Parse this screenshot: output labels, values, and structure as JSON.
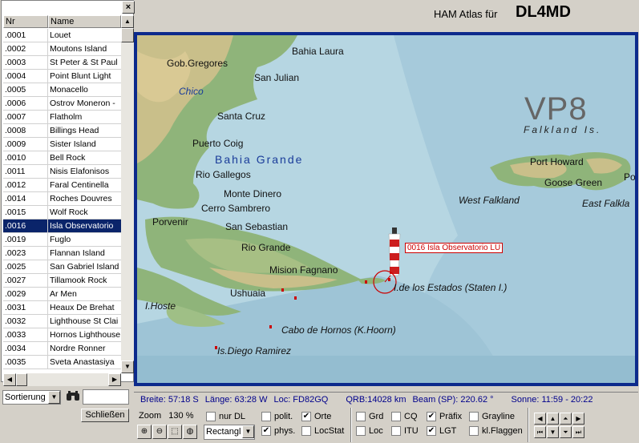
{
  "list": {
    "close_icon": "×",
    "col_nr": "Nr",
    "col_name": "Name",
    "rows": [
      {
        "nr": ".0001",
        "name": "Louet"
      },
      {
        "nr": ".0002",
        "name": "Moutons Island"
      },
      {
        "nr": ".0003",
        "name": "St Peter & St Paul"
      },
      {
        "nr": ".0004",
        "name": "Point Blunt Light"
      },
      {
        "nr": ".0005",
        "name": "Monacello"
      },
      {
        "nr": ".0006",
        "name": "Ostrov Moneron -"
      },
      {
        "nr": ".0007",
        "name": "Flatholm"
      },
      {
        "nr": ".0008",
        "name": "Billings Head"
      },
      {
        "nr": ".0009",
        "name": "Sister Island"
      },
      {
        "nr": ".0010",
        "name": "Bell Rock"
      },
      {
        "nr": ".0011",
        "name": "Nisis Elafonisos"
      },
      {
        "nr": ".0012",
        "name": "Faral Centinella"
      },
      {
        "nr": ".0014",
        "name": "Roches Douvres"
      },
      {
        "nr": ".0015",
        "name": "Wolf Rock"
      },
      {
        "nr": ".0016",
        "name": "Isla Observatorio"
      },
      {
        "nr": ".0019",
        "name": "Fuglo"
      },
      {
        "nr": ".0023",
        "name": "Flannan Island"
      },
      {
        "nr": ".0025",
        "name": "San Gabriel Island"
      },
      {
        "nr": ".0027",
        "name": "Tillamook Rock"
      },
      {
        "nr": ".0029",
        "name": "Ar Men"
      },
      {
        "nr": ".0031",
        "name": "Heaux De Brehat"
      },
      {
        "nr": ".0032",
        "name": "Lighthouse St Clai"
      },
      {
        "nr": ".0033",
        "name": "Hornos Lighthouse"
      },
      {
        "nr": ".0034",
        "name": "Nordre Ronner"
      },
      {
        "nr": ".0035",
        "name": "Sveta Anastasiya"
      }
    ],
    "selected_index": 14
  },
  "controls": {
    "sort_value": "Sortierung",
    "search_icon": "binoculars-icon",
    "close_button": "Schließen"
  },
  "header": {
    "label": "HAM Atlas für",
    "callsign": "DL4MD"
  },
  "map": {
    "prefix": "VP8",
    "region": "Falkland Is.",
    "callout": "0016 Isla Observatorio LU",
    "places": [
      {
        "id": "gob-gregores",
        "text": "Gob.Gregores"
      },
      {
        "id": "bahia-laura",
        "text": "Bahia Laura"
      },
      {
        "id": "san-julian",
        "text": "San Julian"
      },
      {
        "id": "chico",
        "text": "Chico"
      },
      {
        "id": "santa-cruz",
        "text": "Santa Cruz"
      },
      {
        "id": "puerto-coig",
        "text": "Puerto Coig"
      },
      {
        "id": "bahia-grande",
        "text": "Bahia Grande"
      },
      {
        "id": "rio-gallegos",
        "text": "Rio Gallegos"
      },
      {
        "id": "monte-dinero",
        "text": "Monte Dinero"
      },
      {
        "id": "cerro-sambrero",
        "text": "Cerro Sambrero"
      },
      {
        "id": "porvenir",
        "text": "Porvenir"
      },
      {
        "id": "san-sebastian",
        "text": "San Sebastian"
      },
      {
        "id": "rio-grande",
        "text": "Rio Grande"
      },
      {
        "id": "mision-fagnano",
        "text": "Mision Fagnano"
      },
      {
        "id": "ushuaia",
        "text": "Ushuaia"
      },
      {
        "id": "i-hoste",
        "text": "I.Hoste"
      },
      {
        "id": "i-de-los-estados",
        "text": "I.de los Estados (Staten I.)"
      },
      {
        "id": "cabo-de-hornos",
        "text": "Cabo de Hornos (K.Hoorn)"
      },
      {
        "id": "is-diego-ramirez",
        "text": "Is.Diego Ramirez"
      },
      {
        "id": "port-howard",
        "text": "Port Howard"
      },
      {
        "id": "goose-green",
        "text": "Goose Green"
      },
      {
        "id": "west-falkland",
        "text": "West Falkland"
      },
      {
        "id": "east-falkland",
        "text": "East Falkla"
      },
      {
        "id": "po",
        "text": "Po"
      }
    ]
  },
  "status": {
    "breite": "Breite: 57:18 S",
    "laenge": "Länge: 63:28 W",
    "loc": "Loc: FD82GQ",
    "qrb": "QRB:14028 km",
    "beam": "Beam (SP): 220.62 °",
    "sonne": "Sonne: 11:59 - 20:22"
  },
  "bottom": {
    "zoom_label": "Zoom",
    "zoom_value": "130 %",
    "shape_value": "Rectangl",
    "checkboxes": {
      "nur_dl": {
        "label": "nur DL",
        "checked": false
      },
      "polit": {
        "label": "polit.",
        "checked": false
      },
      "orte": {
        "label": "Orte",
        "checked": true
      },
      "phys": {
        "label": "phys.",
        "checked": true
      },
      "locstat": {
        "label": "LocStat",
        "checked": false
      },
      "grd": {
        "label": "Grd",
        "checked": false
      },
      "cq": {
        "label": "CQ",
        "checked": false
      },
      "praefix": {
        "label": "Präfix",
        "checked": true
      },
      "grayline": {
        "label": "Grayline",
        "checked": false
      },
      "loc": {
        "label": "Loc",
        "checked": false
      },
      "itu": {
        "label": "ITU",
        "checked": false
      },
      "lgt": {
        "label": "LGT",
        "checked": true
      },
      "klflaggen": {
        "label": "kl.Flaggen",
        "checked": false
      }
    }
  }
}
